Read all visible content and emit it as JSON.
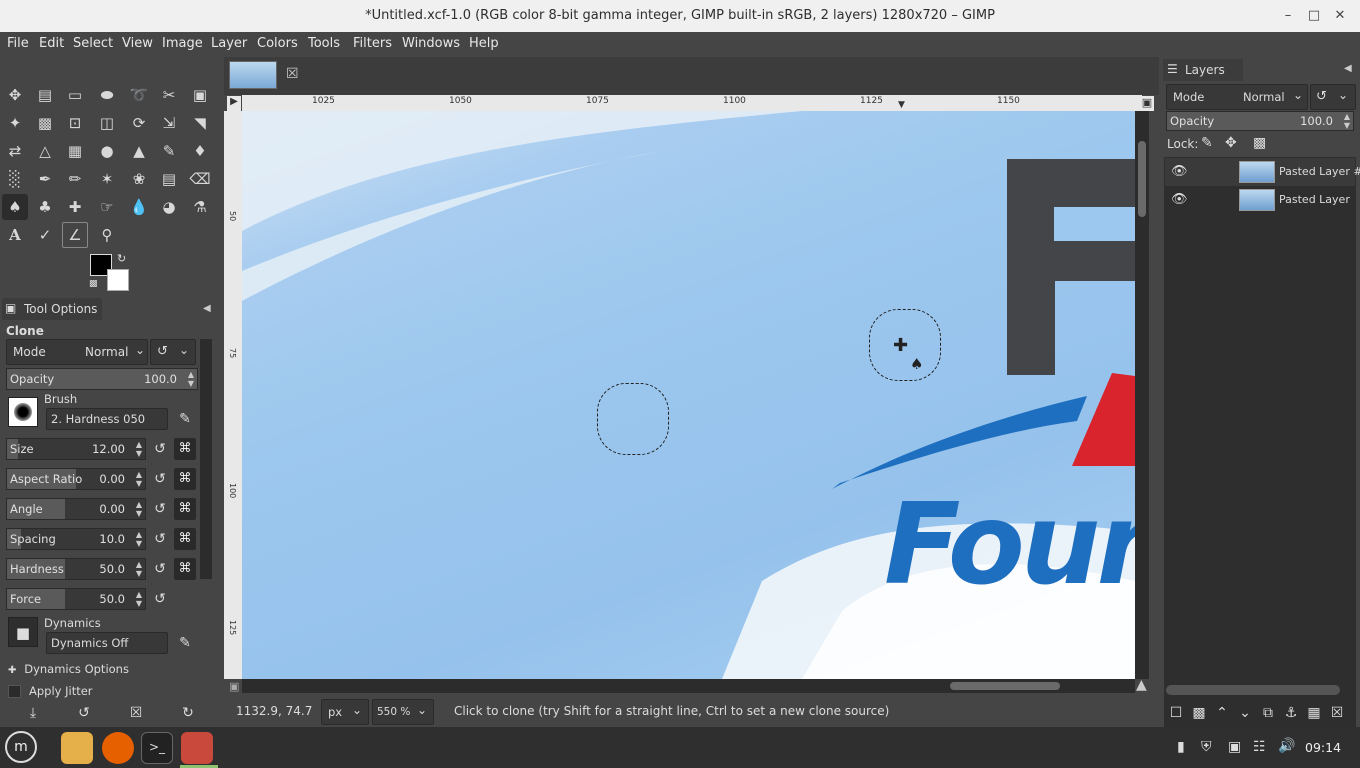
{
  "window": {
    "title": "*Untitled.xcf-1.0 (RGB color 8-bit gamma integer, GIMP built-in sRGB, 2 layers) 1280x720 – GIMP",
    "controls": [
      "minimize-icon",
      "maximize-icon",
      "close-icon"
    ]
  },
  "menu": [
    "File",
    "Edit",
    "Select",
    "View",
    "Image",
    "Layer",
    "Colors",
    "Tools",
    "Filters",
    "Windows",
    "Help"
  ],
  "tool_options": {
    "tab_label": "Tool Options",
    "tool_name": "Clone",
    "mode_label": "Mode",
    "mode_value": "Normal",
    "opacity_label": "Opacity",
    "opacity_value": "100.0",
    "brush_label": "Brush",
    "brush_value": "2. Hardness 050",
    "size_label": "Size",
    "size_value": "12.00",
    "aspect_label": "Aspect Ratio",
    "aspect_value": "0.00",
    "angle_label": "Angle",
    "angle_value": "0.00",
    "spacing_label": "Spacing",
    "spacing_value": "10.0",
    "hardness_label": "Hardness",
    "hardness_value": "50.0",
    "force_label": "Force",
    "force_value": "50.0",
    "dynamics_label": "Dynamics",
    "dynamics_value": "Dynamics Off",
    "dynamics_options_label": "Dynamics Options",
    "apply_jitter_label": "Apply Jitter"
  },
  "rulers": {
    "h_ticks": [
      "1025",
      "1050",
      "1075",
      "1100",
      "1125",
      "1150"
    ],
    "v_ticks": [
      "50",
      "75",
      "100",
      "125"
    ]
  },
  "canvas": {
    "logo_letter_top": "F",
    "logo_word": "Foun"
  },
  "status": {
    "coords": "1132.9, 74.7",
    "unit": "px",
    "zoom": "550 %",
    "message": "Click to clone (try Shift for a straight line, Ctrl to set a new clone source)"
  },
  "layers_panel": {
    "tab_label": "Layers",
    "mode_label": "Mode",
    "mode_value": "Normal",
    "opacity_label": "Opacity",
    "opacity_value": "100.0",
    "lock_label": "Lock:",
    "layers": [
      "Pasted Layer #",
      "Pasted Layer"
    ]
  },
  "taskbar": {
    "clock": "09:14"
  },
  "colors": {
    "accent_selection": "#2c2c2c",
    "logo_blue": "#1f6fc0",
    "logo_red": "#d9232d",
    "logo_gray": "#434548",
    "firefox_orange": "#e66000",
    "gimp_red": "#c94a3d"
  }
}
